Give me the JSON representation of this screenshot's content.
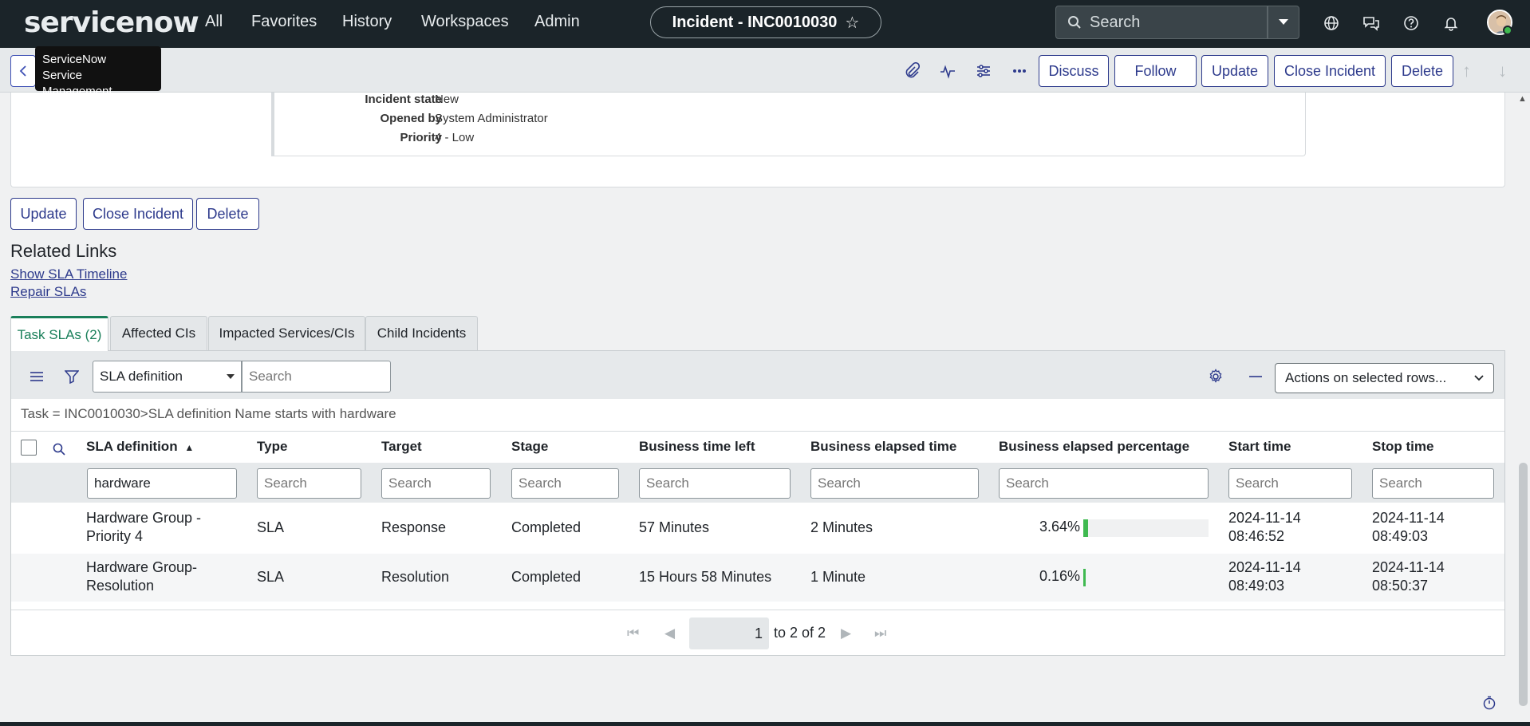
{
  "nav": {
    "logo": "servicenow",
    "items": [
      "All",
      "Favorites",
      "History",
      "Workspaces",
      "Admin"
    ],
    "record_title": "Incident - INC0010030",
    "search_placeholder": "Search"
  },
  "tooltip": {
    "line1": "ServiceNow",
    "line2": "Service Management"
  },
  "header_buttons": {
    "discuss": "Discuss",
    "follow": "Follow",
    "update": "Update",
    "close_incident": "Close Incident",
    "delete": "Delete"
  },
  "fields": [
    {
      "label": "Incident state",
      "value": "New"
    },
    {
      "label": "Opened by",
      "value": "System Administrator"
    },
    {
      "label": "Priority",
      "value": "4 - Low"
    }
  ],
  "bottom_buttons": {
    "update": "Update",
    "close_incident": "Close Incident",
    "delete": "Delete"
  },
  "related": {
    "title": "Related Links",
    "links": [
      "Show SLA Timeline",
      "Repair SLAs"
    ]
  },
  "tabs": [
    "Task SLAs (2)",
    "Affected CIs",
    "Impacted Services/CIs",
    "Child Incidents"
  ],
  "list": {
    "search_field": "SLA definition",
    "search_placeholder": "Search",
    "actions_label": "Actions on selected rows...",
    "breadcrumb": "Task = INC0010030>SLA definition Name starts with hardware",
    "columns": [
      "SLA definition",
      "Type",
      "Target",
      "Stage",
      "Business time left",
      "Business elapsed time",
      "Business elapsed percentage",
      "Start time",
      "Stop time"
    ],
    "filter_values": [
      "hardware",
      "Search",
      "Search",
      "Search",
      "Search",
      "Search",
      "Search",
      "Search",
      "Search"
    ],
    "rows": [
      {
        "definition_l1": "Hardware Group -",
        "definition_l2": "Priority 4",
        "type": "SLA",
        "target": "Response",
        "stage": "Completed",
        "time_left": "57 Minutes",
        "elapsed": "2 Minutes",
        "pct_label": "3.64%",
        "pct": 3.64,
        "start_date": "2024-11-14",
        "start_time": "08:46:52",
        "stop_date": "2024-11-14",
        "stop_time": "08:49:03"
      },
      {
        "definition_l1": "Hardware Group-",
        "definition_l2": "Resolution",
        "type": "SLA",
        "target": "Resolution",
        "stage": "Completed",
        "time_left": "15 Hours 58 Minutes",
        "elapsed": "1 Minute",
        "pct_label": "0.16%",
        "pct": 0.16,
        "start_date": "2024-11-14",
        "start_time": "08:49:03",
        "stop_date": "2024-11-14",
        "stop_time": "08:50:37"
      }
    ],
    "pager": {
      "page": "1",
      "text": "to 2 of 2"
    }
  }
}
